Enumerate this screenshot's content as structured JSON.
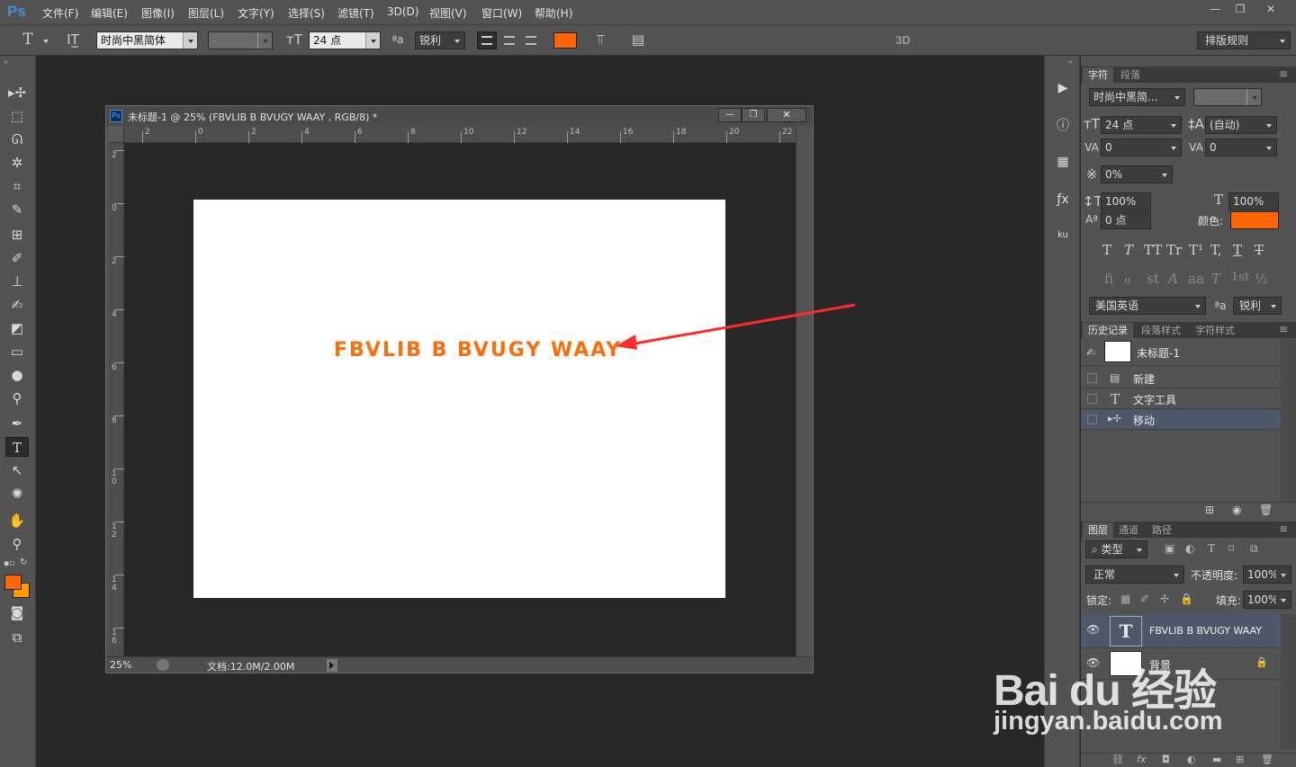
{
  "app": {
    "logo": "Ps"
  },
  "menu": [
    "文件(F)",
    "编辑(E)",
    "图像(I)",
    "图层(L)",
    "文字(Y)",
    "选择(S)",
    "滤镜(T)",
    "3D(D)",
    "视图(V)",
    "窗口(W)",
    "帮助(H)"
  ],
  "window_controls": {
    "minimize": "—",
    "restore": "❐",
    "close": "✕"
  },
  "options": {
    "tool_icon": "T",
    "font_family": "时尚中黑简体",
    "font_style": "-",
    "font_size": "24 点",
    "aa_label": "ªa",
    "antialias": "锐利",
    "color": "#ff6600",
    "threed": "3D",
    "workspace": "排版规则"
  },
  "document": {
    "title": "未标题-1 @ 25% (FBVLIB B BVUGY WAAY , RGB/8) *",
    "ruler_top": [
      "2",
      "0",
      "2",
      "4",
      "6",
      "8",
      "10",
      "12",
      "14",
      "16",
      "18",
      "20",
      "22"
    ],
    "ruler_left": [
      "2",
      "0",
      "2",
      "4",
      "6",
      "8",
      "1 0",
      "1 2",
      "1 4",
      "1 6"
    ],
    "canvas_text": "FBVLIB B BVUGY WAAY",
    "text_color": "#ff6d0b",
    "zoom": "25%",
    "doc_size": "文档:12.0M/2.00M"
  },
  "character_panel": {
    "tabs": [
      "字符",
      "段落"
    ],
    "font_family": "时尚中黑简...",
    "font_style": "-",
    "font_size": "24 点",
    "leading": "(自动)",
    "kerning": "0",
    "tracking": "0",
    "tsume": "0%",
    "vscale": "100%",
    "hscale": "100%",
    "baseline": "0 点",
    "color_label": "颜色:",
    "color": "#ff6600",
    "style_buttons": [
      "T",
      "T",
      "TT",
      "Tr",
      "T¹",
      "T,",
      "T",
      "T"
    ],
    "opentype_buttons": [
      "fi",
      "ℴ",
      "st",
      "A",
      "aa",
      "T",
      "1st",
      "½"
    ],
    "language": "美国英语",
    "aa_label": "ªa",
    "antialias": "锐利"
  },
  "history_panel": {
    "tabs": [
      "历史记录",
      "段落样式",
      "字符样式"
    ],
    "snapshot": "未标题-1",
    "items": [
      {
        "label": "新建",
        "icon": "document-icon"
      },
      {
        "label": "文字工具",
        "icon": "type-icon"
      },
      {
        "label": "移动",
        "icon": "move-icon"
      }
    ]
  },
  "layers_panel": {
    "tabs": [
      "图层",
      "通道",
      "路径"
    ],
    "filter": "类型",
    "blend_mode": "正常",
    "opacity_label": "不透明度:",
    "opacity": "100%",
    "lock_label": "锁定:",
    "fill_label": "填充:",
    "fill": "100%",
    "layers": [
      {
        "name": "FBVLIB B BVUGY WAAY",
        "type": "text",
        "selected": true
      },
      {
        "name": "背景",
        "type": "background",
        "selected": false
      }
    ]
  },
  "watermark": {
    "brand": "Bai du 经验",
    "url": "jingyan.baidu.com"
  }
}
